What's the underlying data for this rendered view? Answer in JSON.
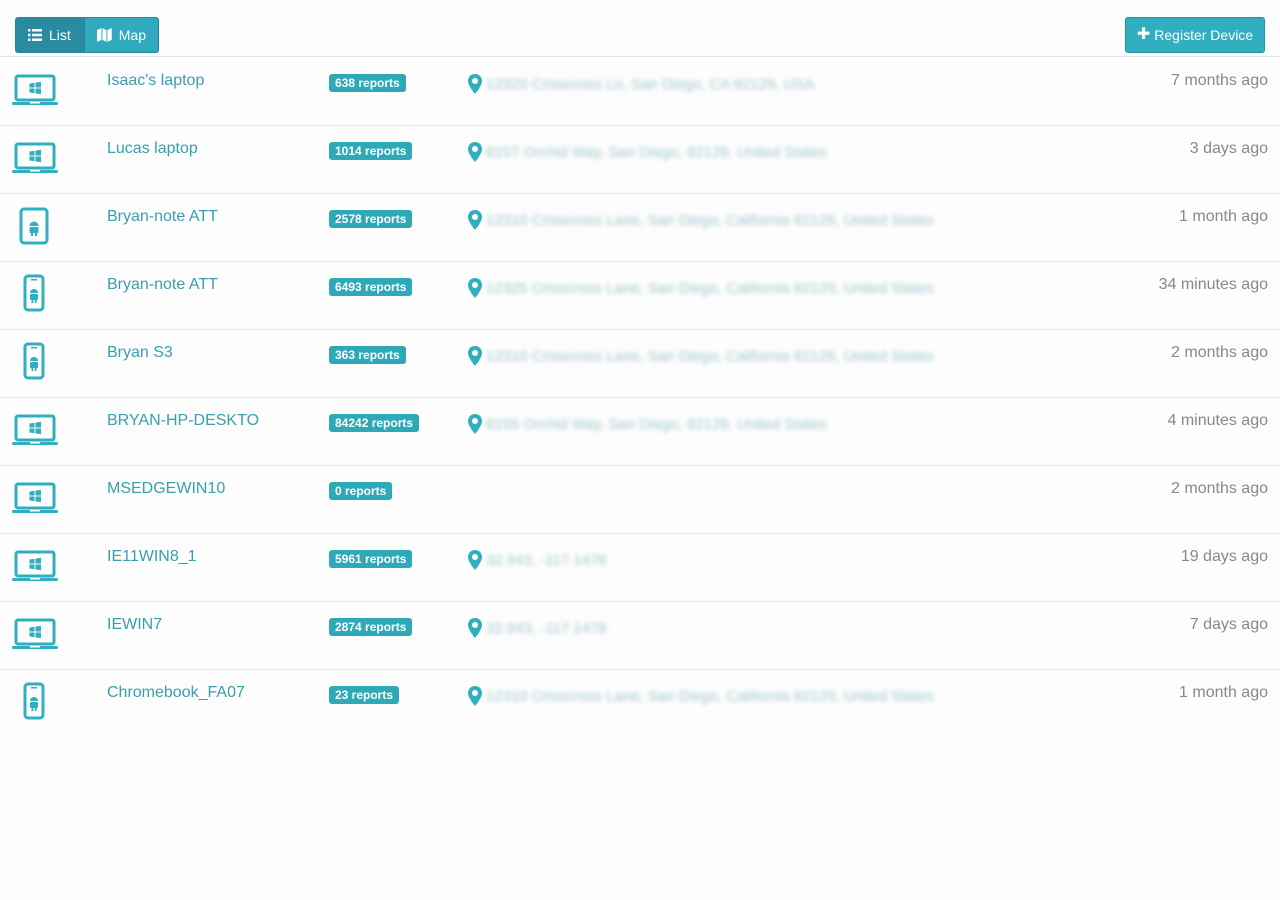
{
  "toolbar": {
    "list_label": "List",
    "map_label": "Map",
    "register_label": "Register Device"
  },
  "devices": [
    {
      "icon": "laptop-windows-icon",
      "name": "Isaac's laptop",
      "reports": "638 reports",
      "address": "12320 Crisscross Ln, San Diego, CA 92129, USA",
      "time": "7 months ago"
    },
    {
      "icon": "laptop-windows-icon",
      "name": "Lucas laptop",
      "reports": "1014 reports",
      "address": "8157 Orchid Way, San Diego, 92129, United States",
      "time": "3 days ago"
    },
    {
      "icon": "tablet-android-icon",
      "name": "Bryan-note ATT",
      "reports": "2578 reports",
      "address": "12310 Crisscross Lane, San Diego, California 92129, United States",
      "time": "1 month ago"
    },
    {
      "icon": "phone-android-icon",
      "name": "Bryan-note ATT",
      "reports": "6493 reports",
      "address": "12325 Crisscross Lane, San Diego, California 92129, United States",
      "time": "34 minutes ago"
    },
    {
      "icon": "phone-android-icon",
      "name": "Bryan S3",
      "reports": "363 reports",
      "address": "12310 Crisscross Lane, San Diego, California 92129, United States",
      "time": "2 months ago"
    },
    {
      "icon": "laptop-windows-icon",
      "name": "BRYAN-HP-DESKTO",
      "reports": "84242 reports",
      "address": "8155 Orchid Way, San Diego, 92129, United States",
      "time": "4 minutes ago"
    },
    {
      "icon": "laptop-windows-icon",
      "name": "MSEDGEWIN10",
      "reports": "0 reports",
      "address": "",
      "time": "2 months ago"
    },
    {
      "icon": "laptop-windows-icon",
      "name": "IE11WIN8_1",
      "reports": "5961 reports",
      "address": "32.943, -117.1478",
      "time": "19 days ago"
    },
    {
      "icon": "laptop-windows-icon",
      "name": "IEWIN7",
      "reports": "2874 reports",
      "address": "32.943, -117.1478",
      "time": "7 days ago"
    },
    {
      "icon": "phone-android-icon",
      "name": "Chromebook_FA07",
      "reports": "23 reports",
      "address": "12310 Crisscross Lane, San Diego, California 92129, United States",
      "time": "1 month ago"
    }
  ],
  "colors": {
    "accent": "#31aebf",
    "link": "#3a9ead",
    "muted": "#888888"
  }
}
